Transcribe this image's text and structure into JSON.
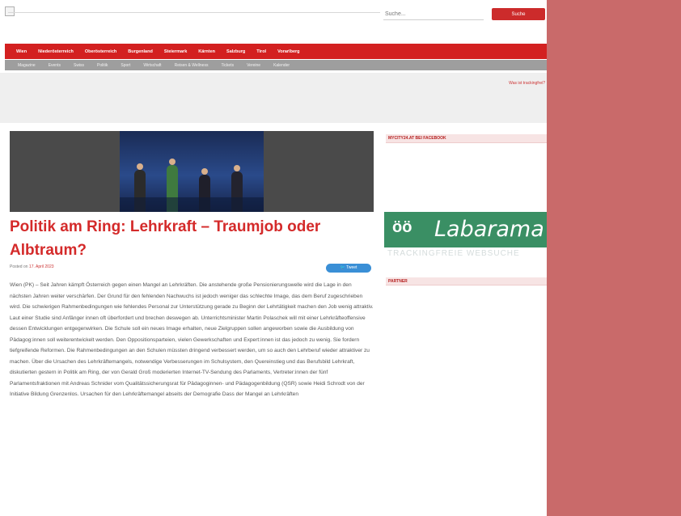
{
  "header": {
    "search_placeholder": "Suche...",
    "search_button": "Suche"
  },
  "nav": {
    "primary": [
      "Wien",
      "Niederösterreich",
      "Oberösterreich",
      "Burgenland",
      "Steiermark",
      "Kärnten",
      "Salzburg",
      "Tirol",
      "Vorarlberg"
    ],
    "secondary": [
      "Magazine",
      "Events",
      "Swiss",
      "Politik",
      "Sport",
      "Wirtschaft",
      "Reisen & Wellness",
      "Tickets",
      "Vereine",
      "Kalender"
    ]
  },
  "ad": {
    "link": "Was ist trackingfrei?"
  },
  "article": {
    "title": "Politik am Ring: Lehrkraft – Traumjob oder Albtraum?",
    "posted_prefix": "Posted on",
    "date": "17. April 2023",
    "tweet_label": "Tweet",
    "body": "Wien (PK) – Seit Jahren kämpft Österreich gegen einen Mangel an Lehrkräften. Die anstehende große Pensionierungswelle wird die Lage in den nächsten Jahren weiter verschärfen. Der Grund für den fehlenden Nachwuchs ist jedoch weniger das schlechte Image, das dem Beruf zugeschrieben wird. Die schwierigen Rahmenbedingungen wie fehlendes Personal zur Unterstützung gerade zu Beginn der Lehrtätigkeit machen den Job wenig attraktiv. Laut einer Studie sind Anfänger innen oft überfordert und brechen deswegen ab. Unterrichtsminister Martin Polaschek will mit einer Lehrkräfteoffensive dessen Entwicklungen entgegenwirken. Die Schule soll ein neues Image erhalten, neue Zielgruppen sollen angeworben sowie die Ausbildung von Pädagog:innen soll weiterentwickelt werden. Den Oppositionsparteien, vielen Gewerkschaften und Expert:innen ist das jedoch zu wenig. Sie fordern tiefgreifende Reformen. Die Rahmenbedingungen an den Schulen müssten dringend verbessert werden, um so auch den Lehrberuf wieder attraktiver zu machen. Über die Ursachen des Lehrkräftemangels, notwendige Verbesserungen im Schulsystem, den Quereinstieg und das Berufsbild Lehrkraft, diskutierten gestern in Politik am Ring, der von Gerald Groß moderierten Internet-TV-Sendung des Parlaments, Vertreter:innen der fünf Parlamentsfraktionen mit Andreas Schnider vom Qualitätssicherungsrat für Pädagoginnen- und Pädagogenbildung (QSR) sowie Heidi Schrodt von der Initiative Bildung Grenzenlos. Ursachen für den Lehrkräftemangel abseits der Demografie Dass der Mangel an Lehrkräften"
  },
  "sidebar": {
    "facebook_title": "MYCITY24.AT BEI FACEBOOK",
    "logo_text": "Labarama",
    "logo_icon": "smiley-eyes-icon",
    "logo_subtitle": "TRACKINGFREIE WEBSUCHE",
    "box2_title": "PARTNER"
  },
  "colors": {
    "brand_red": "#d32020",
    "subnav_gray": "#9e9e9e",
    "logo_green": "#3a8f64",
    "right_overlay": "#c96a6a"
  }
}
